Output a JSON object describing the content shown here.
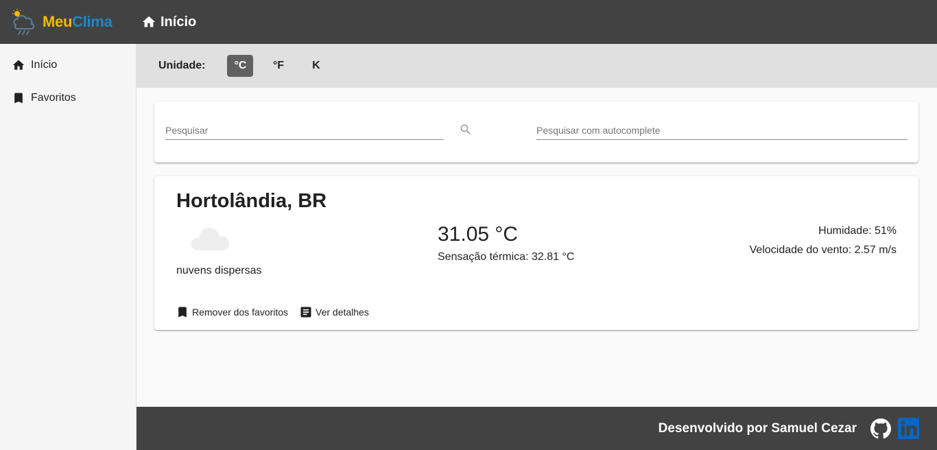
{
  "app": {
    "logo_part1": "Meu",
    "logo_part2": "Clima",
    "page_title": "Início"
  },
  "sidebar": {
    "items": [
      {
        "label": "Início",
        "icon": "home-icon"
      },
      {
        "label": "Favoritos",
        "icon": "bookmark-icon"
      }
    ]
  },
  "units": {
    "label": "Unidade:",
    "options": [
      "°C",
      "°F",
      "K"
    ],
    "selected": "°C"
  },
  "search": {
    "placeholder": "Pesquisar",
    "autocomplete_placeholder": "Pesquisar com autocomplete"
  },
  "weather": {
    "city": "Hortolândia, BR",
    "icon": "cloud-icon",
    "description": "nuvens dispersas",
    "temperature": "31.05 °C",
    "feels_like": "Sensação térmica: 32.81 °C",
    "humidity": "Humidade: 51%",
    "wind_speed": "Velocidade do vento: 2.57 m/s",
    "remove_favorite_label": "Remover dos favoritos",
    "details_label": "Ver detalhes"
  },
  "footer": {
    "credit": "Desenvolvido por Samuel Cezar",
    "icons": [
      "github-icon",
      "linkedin-icon"
    ]
  },
  "colors": {
    "appbar": "#424242",
    "logo_meu": "#f5b800",
    "logo_clima": "#1e88c7",
    "unitbar": "#e0e0e0",
    "unit_active": "#616161",
    "linkedin": "#0a66c2"
  }
}
